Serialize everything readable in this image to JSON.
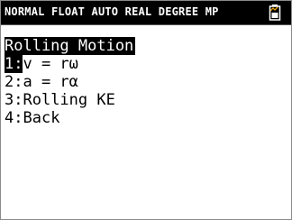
{
  "status_bar": {
    "text": "NORMAL FLOAT AUTO REAL DEGREE MP",
    "battery_icon": "battery-icon"
  },
  "menu": {
    "title": "Rolling Motion",
    "selected_index": 0,
    "items": [
      {
        "number": "1:",
        "label": "v = rω"
      },
      {
        "number": "2:",
        "label": "a = rα"
      },
      {
        "number": "3:",
        "label": "Rolling KE"
      },
      {
        "number": "4:",
        "label": "Back"
      }
    ]
  },
  "colors": {
    "status_bar_bg": "#000000",
    "highlight_bg": "#000000",
    "screen_bg": "#ffffff",
    "battery_accent": "#e8a000"
  }
}
